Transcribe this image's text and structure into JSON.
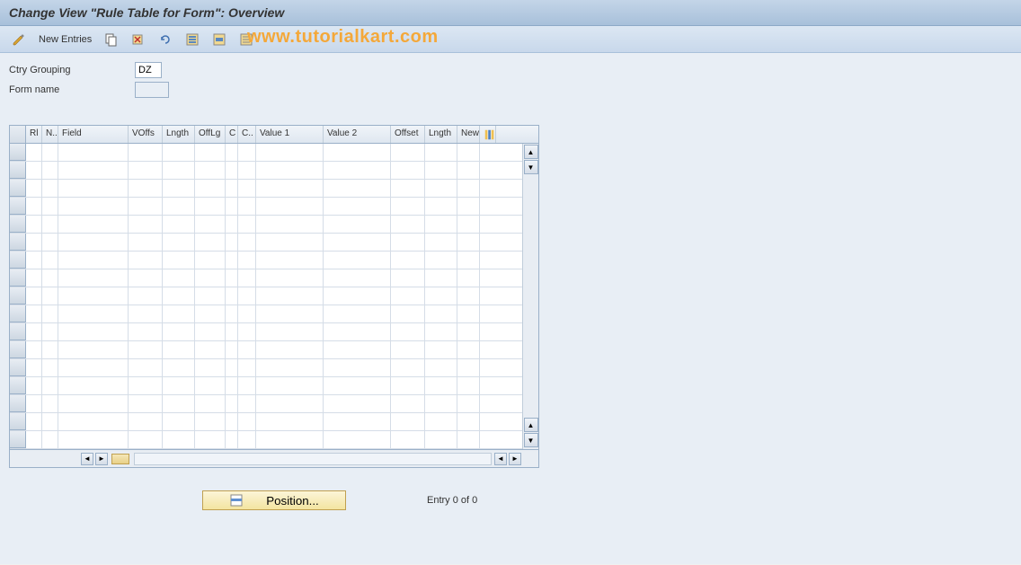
{
  "header": {
    "title": "Change View \"Rule Table for Form\": Overview"
  },
  "toolbar": {
    "new_entries_label": "New Entries"
  },
  "watermark": "www.tutorialkart.com",
  "form": {
    "ctry_grouping_label": "Ctry Grouping",
    "ctry_grouping_value": "DZ",
    "form_name_label": "Form name",
    "form_name_value": ""
  },
  "grid": {
    "columns": {
      "rl": "Rl",
      "n": "N..",
      "field": "Field",
      "voffs": "VOffs",
      "lngth1": "Lngth",
      "offlg": "OffLg",
      "c1": "C",
      "c2": "C..",
      "val1": "Value 1",
      "val2": "Value 2",
      "offset": "Offset",
      "lngth2": "Lngth",
      "new": "New"
    },
    "row_count": 17
  },
  "footer": {
    "position_label": "Position...",
    "entry_label": "Entry 0 of 0"
  }
}
